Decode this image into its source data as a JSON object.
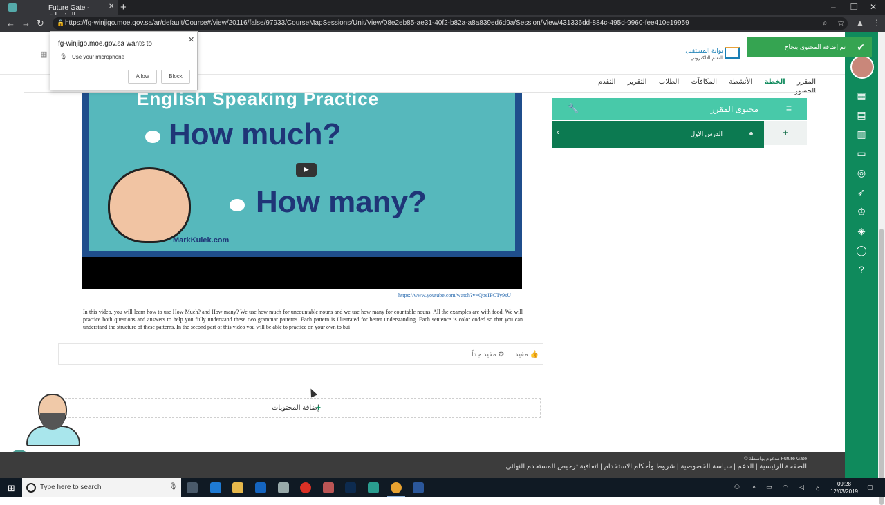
{
  "browser": {
    "tab_title": "Future Gate - المقررات",
    "url": "https://fg-winjigo.moe.gov.sa/ar/default/Course#/view/20116/false/97933/CourseMapSessions/Unit/View/08e2eb85-ae31-40f2-b82a-a8a839ed6d9a/Session/View/431336dd-884c-495d-9960-fee410e19959"
  },
  "permission_popup": {
    "title": "fg-winjigo.moe.gov.sa wants to",
    "request": "Use your microphone",
    "allow_label": "Allow",
    "block_label": "Block"
  },
  "toast": {
    "message": "تم إضافة المحتوى بنجاح",
    "color": "#35a451"
  },
  "header": {
    "logo_title": "بوابة المستقبل",
    "logo_subtitle": "التعلم الالكتروني"
  },
  "nav": {
    "items": [
      {
        "label": "المقرر",
        "active": false
      },
      {
        "label": "الخطة",
        "active": true
      },
      {
        "label": "الأنشطة",
        "active": false
      },
      {
        "label": "المكافآت",
        "active": false
      },
      {
        "label": "الطلاب",
        "active": false
      },
      {
        "label": "التقرير",
        "active": false
      },
      {
        "label": "التقدم",
        "active": false
      },
      {
        "label": "الحضور",
        "active": false
      }
    ]
  },
  "course_panel": {
    "title": "محتوى المقرر",
    "lesson_label": "الدرس الاول",
    "add_label": "+"
  },
  "video": {
    "thumbnail_title": "English Speaking Practice",
    "question_1": "How much?",
    "question_2": "How many?",
    "brand": "MarkKulek.com",
    "link": "https://www.youtube.com/watch?v=QbeIFCTy9sU",
    "description": "In this video, you will learn how to use How Much? and How many? We use how much for uncountable nouns and we use how many for countable nouns. All the examples are with food. We will practice both questions and answers to help you fully understand these two grammar patterns. Each pattern is illustrated for better understanding. Each sentence is color coded so that you can understand the structure of these patterns. In the second part of this video you will be able to practice on your own to bui"
  },
  "feedback": {
    "useful_label": "مفيد",
    "very_useful_label": "مفيد جداً"
  },
  "add_content": {
    "label": "إضافة المحتويات"
  },
  "footer": {
    "powered_by": "© مدعوم بواسطة Future Gate",
    "links": [
      "الصفحة الرئيسية",
      "الدعم",
      "سياسة الخصوصية",
      "شروط وأحكام الاستخدام",
      "اتفاقية ترخيص المستخدم النهائي"
    ]
  },
  "taskbar": {
    "search_placeholder": "Type here to search",
    "time": "09:28",
    "date": "12/03/2019",
    "lang": "ع"
  },
  "colors": {
    "sidebar": "#0f8a5c",
    "panel_header": "#48c9a9",
    "lesson_row": "#0c7a51",
    "footer": "#3c3c3c"
  },
  "icons": {
    "sidebar": [
      "dashboard-icon",
      "presentation-icon",
      "calculator-icon",
      "card-icon",
      "user-search-icon",
      "rocket-icon",
      "trophy-icon",
      "ticket-icon",
      "lifebuoy-icon",
      "help-icon"
    ]
  }
}
